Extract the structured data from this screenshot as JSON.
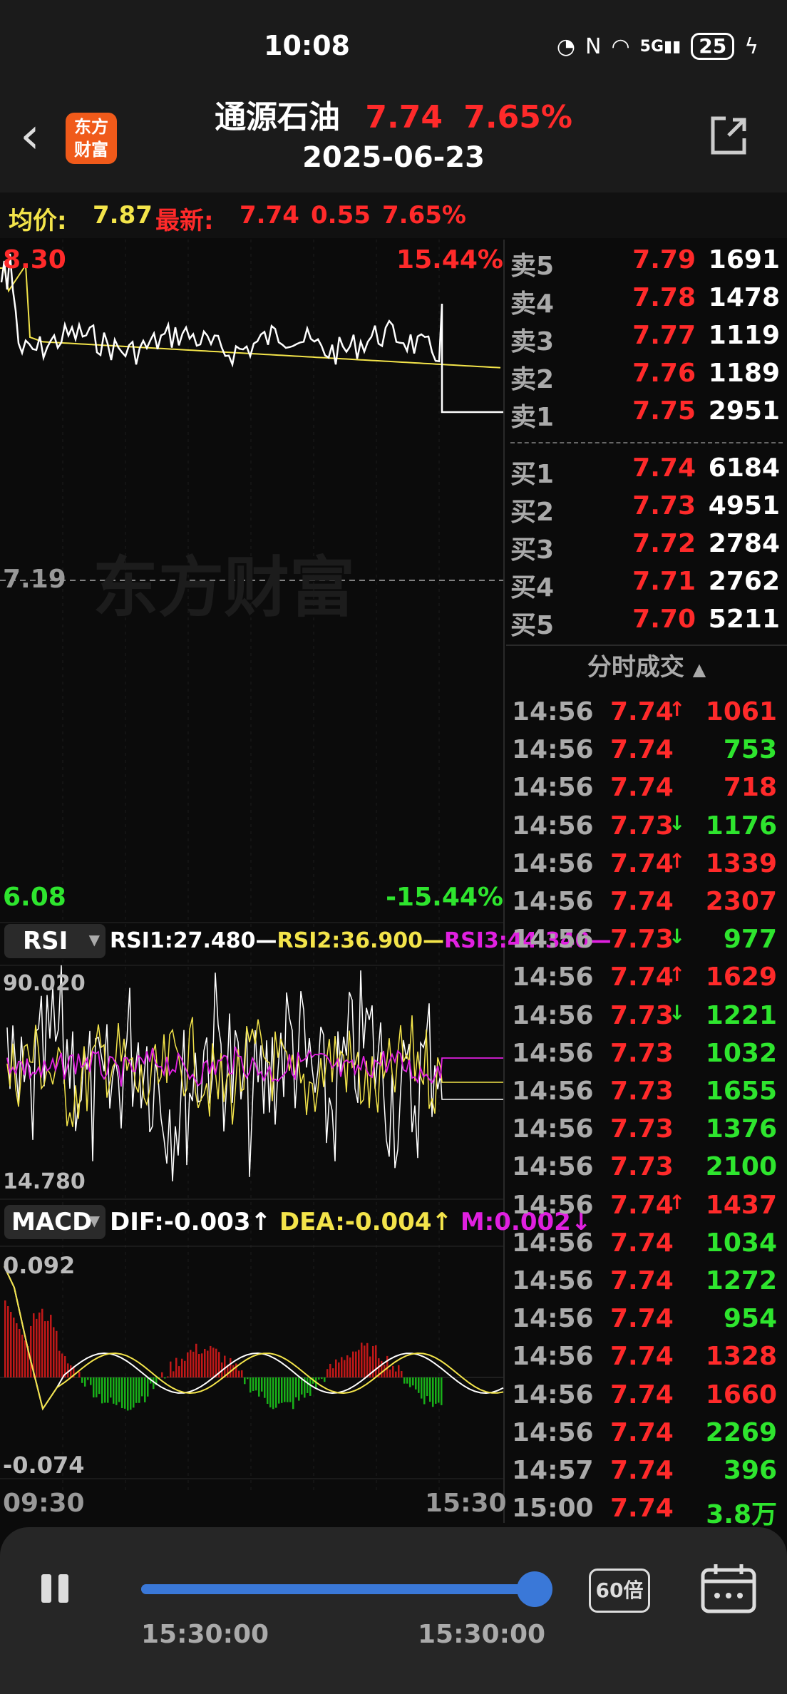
{
  "status_bar": {
    "time": "10:08",
    "network": "5G",
    "battery": "25"
  },
  "header": {
    "stock_name": "通源石油",
    "price": "7.74",
    "change_pct": "7.65%",
    "date": "2025-06-23",
    "logo_text": "东方财富"
  },
  "info_bar": {
    "avg_label": "均价:",
    "avg_value": "7.87",
    "latest_label": "最新:",
    "latest_price": "7.74",
    "latest_change": "0.55",
    "latest_pct": "7.65%"
  },
  "price_chart": {
    "high": "8.30",
    "high_pct": "15.44%",
    "base": "7.19",
    "low": "6.08",
    "low_pct": "-15.44%",
    "watermark": "东方财富"
  },
  "rsi": {
    "selector": "RSI",
    "rsi1": "RSI1:27.480",
    "rsi2": "RSI2:36.900",
    "rsi3": "RSI3:44.340",
    "max": "90.020",
    "min": "14.780"
  },
  "macd": {
    "selector": "MACD",
    "dif": "DIF:-0.003",
    "dea": "DEA:-0.004",
    "m": "M:0.002",
    "max": "0.092",
    "min": "-0.074"
  },
  "time_axis": {
    "start": "09:30",
    "end": "15:30"
  },
  "order_book": {
    "asks": [
      {
        "label": "卖5",
        "price": "7.79",
        "vol": "1691"
      },
      {
        "label": "卖4",
        "price": "7.78",
        "vol": "1478"
      },
      {
        "label": "卖3",
        "price": "7.77",
        "vol": "1119"
      },
      {
        "label": "卖2",
        "price": "7.76",
        "vol": "1189"
      },
      {
        "label": "卖1",
        "price": "7.75",
        "vol": "2951"
      }
    ],
    "bids": [
      {
        "label": "买1",
        "price": "7.74",
        "vol": "6184"
      },
      {
        "label": "买2",
        "price": "7.73",
        "vol": "4951"
      },
      {
        "label": "买3",
        "price": "7.72",
        "vol": "2784"
      },
      {
        "label": "买4",
        "price": "7.71",
        "vol": "2762"
      },
      {
        "label": "买5",
        "price": "7.70",
        "vol": "5211"
      }
    ]
  },
  "trades": {
    "header": "分时成交",
    "rows": [
      {
        "time": "14:56",
        "price": "7.74",
        "dir": "up",
        "vol": "1061",
        "color": "red"
      },
      {
        "time": "14:56",
        "price": "7.74",
        "dir": "",
        "vol": "753",
        "color": "green"
      },
      {
        "time": "14:56",
        "price": "7.74",
        "dir": "",
        "vol": "718",
        "color": "red"
      },
      {
        "time": "14:56",
        "price": "7.73",
        "dir": "down",
        "vol": "1176",
        "color": "green"
      },
      {
        "time": "14:56",
        "price": "7.74",
        "dir": "up",
        "vol": "1339",
        "color": "red"
      },
      {
        "time": "14:56",
        "price": "7.74",
        "dir": "",
        "vol": "2307",
        "color": "red"
      },
      {
        "time": "14:56",
        "price": "7.73",
        "dir": "down",
        "vol": "977",
        "color": "green"
      },
      {
        "time": "14:56",
        "price": "7.74",
        "dir": "up",
        "vol": "1629",
        "color": "red"
      },
      {
        "time": "14:56",
        "price": "7.73",
        "dir": "down",
        "vol": "1221",
        "color": "green"
      },
      {
        "time": "14:56",
        "price": "7.73",
        "dir": "",
        "vol": "1032",
        "color": "green"
      },
      {
        "time": "14:56",
        "price": "7.73",
        "dir": "",
        "vol": "1655",
        "color": "green"
      },
      {
        "time": "14:56",
        "price": "7.73",
        "dir": "",
        "vol": "1376",
        "color": "green"
      },
      {
        "time": "14:56",
        "price": "7.73",
        "dir": "",
        "vol": "2100",
        "color": "green"
      },
      {
        "time": "14:56",
        "price": "7.74",
        "dir": "up",
        "vol": "1437",
        "color": "red"
      },
      {
        "time": "14:56",
        "price": "7.74",
        "dir": "",
        "vol": "1034",
        "color": "green"
      },
      {
        "time": "14:56",
        "price": "7.74",
        "dir": "",
        "vol": "1272",
        "color": "green"
      },
      {
        "time": "14:56",
        "price": "7.74",
        "dir": "",
        "vol": "954",
        "color": "green"
      },
      {
        "time": "14:56",
        "price": "7.74",
        "dir": "",
        "vol": "1328",
        "color": "red"
      },
      {
        "time": "14:56",
        "price": "7.74",
        "dir": "",
        "vol": "1660",
        "color": "red"
      },
      {
        "time": "14:56",
        "price": "7.74",
        "dir": "",
        "vol": "2269",
        "color": "green"
      },
      {
        "time": "14:57",
        "price": "7.74",
        "dir": "",
        "vol": "396",
        "color": "green"
      },
      {
        "time": "15:00",
        "price": "7.74",
        "dir": "",
        "vol": "3.8万",
        "color": "green"
      }
    ]
  },
  "player": {
    "speed": "60倍",
    "time_start": "15:30:00",
    "time_end": "15:30:00",
    "progress": 1.0
  },
  "colors": {
    "up": "#ff2a2a",
    "down": "#2ee52e",
    "avg_line": "#f3e44a",
    "price_line": "#ffffff",
    "rsi3": "#e020e0",
    "progress": "#3a78d8"
  }
}
